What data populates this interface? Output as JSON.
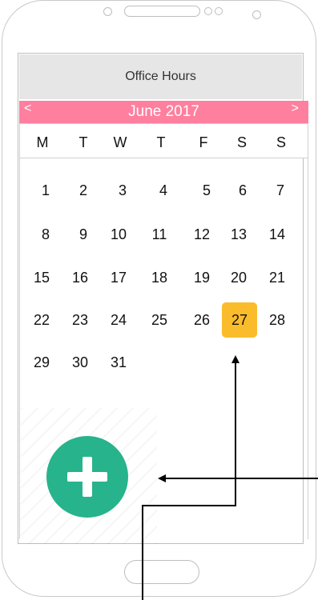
{
  "header": {
    "title": "Office Hours"
  },
  "calendar": {
    "month_label": "June 2017",
    "prev_label": "<",
    "next_label": ">",
    "weekdays": [
      "M",
      "T",
      "W",
      "T",
      "F",
      "S",
      "S"
    ],
    "days": [
      "1",
      "2",
      "3",
      "4",
      "5",
      "6",
      "7",
      "8",
      "9",
      "10",
      "11",
      "12",
      "13",
      "14",
      "15",
      "16",
      "17",
      "18",
      "19",
      "20",
      "21",
      "22",
      "23",
      "24",
      "25",
      "26",
      "27",
      "28",
      "29",
      "30",
      "31"
    ],
    "selected_day": "27"
  },
  "fab": {
    "icon": "plus-icon"
  },
  "colors": {
    "month_bar": "#ff7f9e",
    "selected": "#fbbc2c",
    "fab": "#27b38b",
    "title_bar": "#e6e6e6"
  }
}
